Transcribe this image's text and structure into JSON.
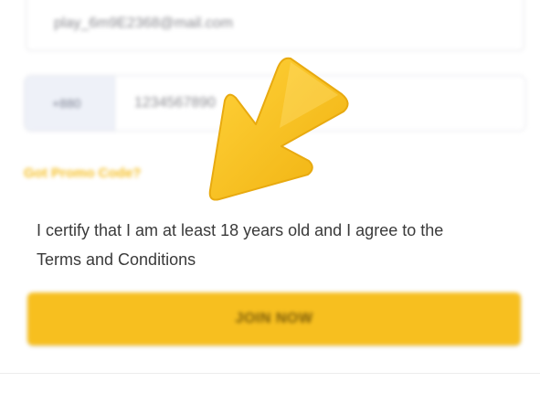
{
  "form": {
    "email_value": "play_6m9E2368@mail.com",
    "phone_code": "+880",
    "phone_value": "1234567890",
    "promo_link": "Got Promo Code?",
    "certify_line1": "I certify that I am at least 18 years old and I agree to the",
    "certify_line2": "Terms and Conditions",
    "join_button": "JOIN NOW"
  },
  "colors": {
    "accent": "#f7bf1f",
    "arrow": "#f5bd1e",
    "input_border": "#e4e4e8",
    "code_bg": "#eef1f8"
  },
  "icons": {
    "pointer": "arrow-pointer-icon"
  }
}
